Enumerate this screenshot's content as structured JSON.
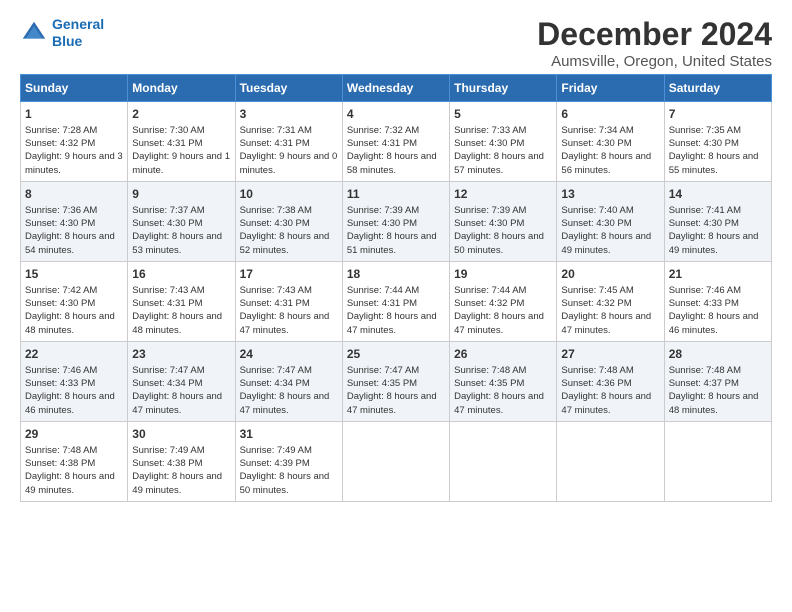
{
  "logo": {
    "line1": "General",
    "line2": "Blue"
  },
  "title": "December 2024",
  "subtitle": "Aumsville, Oregon, United States",
  "days_of_week": [
    "Sunday",
    "Monday",
    "Tuesday",
    "Wednesday",
    "Thursday",
    "Friday",
    "Saturday"
  ],
  "weeks": [
    [
      {
        "day": "1",
        "rise": "Sunrise: 7:28 AM",
        "set": "Sunset: 4:32 PM",
        "daylight": "Daylight: 9 hours and 3 minutes."
      },
      {
        "day": "2",
        "rise": "Sunrise: 7:30 AM",
        "set": "Sunset: 4:31 PM",
        "daylight": "Daylight: 9 hours and 1 minute."
      },
      {
        "day": "3",
        "rise": "Sunrise: 7:31 AM",
        "set": "Sunset: 4:31 PM",
        "daylight": "Daylight: 9 hours and 0 minutes."
      },
      {
        "day": "4",
        "rise": "Sunrise: 7:32 AM",
        "set": "Sunset: 4:31 PM",
        "daylight": "Daylight: 8 hours and 58 minutes."
      },
      {
        "day": "5",
        "rise": "Sunrise: 7:33 AM",
        "set": "Sunset: 4:30 PM",
        "daylight": "Daylight: 8 hours and 57 minutes."
      },
      {
        "day": "6",
        "rise": "Sunrise: 7:34 AM",
        "set": "Sunset: 4:30 PM",
        "daylight": "Daylight: 8 hours and 56 minutes."
      },
      {
        "day": "7",
        "rise": "Sunrise: 7:35 AM",
        "set": "Sunset: 4:30 PM",
        "daylight": "Daylight: 8 hours and 55 minutes."
      }
    ],
    [
      {
        "day": "8",
        "rise": "Sunrise: 7:36 AM",
        "set": "Sunset: 4:30 PM",
        "daylight": "Daylight: 8 hours and 54 minutes."
      },
      {
        "day": "9",
        "rise": "Sunrise: 7:37 AM",
        "set": "Sunset: 4:30 PM",
        "daylight": "Daylight: 8 hours and 53 minutes."
      },
      {
        "day": "10",
        "rise": "Sunrise: 7:38 AM",
        "set": "Sunset: 4:30 PM",
        "daylight": "Daylight: 8 hours and 52 minutes."
      },
      {
        "day": "11",
        "rise": "Sunrise: 7:39 AM",
        "set": "Sunset: 4:30 PM",
        "daylight": "Daylight: 8 hours and 51 minutes."
      },
      {
        "day": "12",
        "rise": "Sunrise: 7:39 AM",
        "set": "Sunset: 4:30 PM",
        "daylight": "Daylight: 8 hours and 50 minutes."
      },
      {
        "day": "13",
        "rise": "Sunrise: 7:40 AM",
        "set": "Sunset: 4:30 PM",
        "daylight": "Daylight: 8 hours and 49 minutes."
      },
      {
        "day": "14",
        "rise": "Sunrise: 7:41 AM",
        "set": "Sunset: 4:30 PM",
        "daylight": "Daylight: 8 hours and 49 minutes."
      }
    ],
    [
      {
        "day": "15",
        "rise": "Sunrise: 7:42 AM",
        "set": "Sunset: 4:30 PM",
        "daylight": "Daylight: 8 hours and 48 minutes."
      },
      {
        "day": "16",
        "rise": "Sunrise: 7:43 AM",
        "set": "Sunset: 4:31 PM",
        "daylight": "Daylight: 8 hours and 48 minutes."
      },
      {
        "day": "17",
        "rise": "Sunrise: 7:43 AM",
        "set": "Sunset: 4:31 PM",
        "daylight": "Daylight: 8 hours and 47 minutes."
      },
      {
        "day": "18",
        "rise": "Sunrise: 7:44 AM",
        "set": "Sunset: 4:31 PM",
        "daylight": "Daylight: 8 hours and 47 minutes."
      },
      {
        "day": "19",
        "rise": "Sunrise: 7:44 AM",
        "set": "Sunset: 4:32 PM",
        "daylight": "Daylight: 8 hours and 47 minutes."
      },
      {
        "day": "20",
        "rise": "Sunrise: 7:45 AM",
        "set": "Sunset: 4:32 PM",
        "daylight": "Daylight: 8 hours and 47 minutes."
      },
      {
        "day": "21",
        "rise": "Sunrise: 7:46 AM",
        "set": "Sunset: 4:33 PM",
        "daylight": "Daylight: 8 hours and 46 minutes."
      }
    ],
    [
      {
        "day": "22",
        "rise": "Sunrise: 7:46 AM",
        "set": "Sunset: 4:33 PM",
        "daylight": "Daylight: 8 hours and 46 minutes."
      },
      {
        "day": "23",
        "rise": "Sunrise: 7:47 AM",
        "set": "Sunset: 4:34 PM",
        "daylight": "Daylight: 8 hours and 47 minutes."
      },
      {
        "day": "24",
        "rise": "Sunrise: 7:47 AM",
        "set": "Sunset: 4:34 PM",
        "daylight": "Daylight: 8 hours and 47 minutes."
      },
      {
        "day": "25",
        "rise": "Sunrise: 7:47 AM",
        "set": "Sunset: 4:35 PM",
        "daylight": "Daylight: 8 hours and 47 minutes."
      },
      {
        "day": "26",
        "rise": "Sunrise: 7:48 AM",
        "set": "Sunset: 4:35 PM",
        "daylight": "Daylight: 8 hours and 47 minutes."
      },
      {
        "day": "27",
        "rise": "Sunrise: 7:48 AM",
        "set": "Sunset: 4:36 PM",
        "daylight": "Daylight: 8 hours and 47 minutes."
      },
      {
        "day": "28",
        "rise": "Sunrise: 7:48 AM",
        "set": "Sunset: 4:37 PM",
        "daylight": "Daylight: 8 hours and 48 minutes."
      }
    ],
    [
      {
        "day": "29",
        "rise": "Sunrise: 7:48 AM",
        "set": "Sunset: 4:38 PM",
        "daylight": "Daylight: 8 hours and 49 minutes."
      },
      {
        "day": "30",
        "rise": "Sunrise: 7:49 AM",
        "set": "Sunset: 4:38 PM",
        "daylight": "Daylight: 8 hours and 49 minutes."
      },
      {
        "day": "31",
        "rise": "Sunrise: 7:49 AM",
        "set": "Sunset: 4:39 PM",
        "daylight": "Daylight: 8 hours and 50 minutes."
      },
      null,
      null,
      null,
      null
    ]
  ]
}
